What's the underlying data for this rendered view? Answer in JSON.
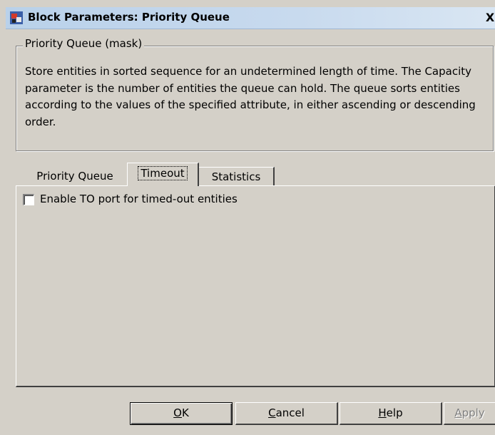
{
  "window": {
    "title": "Block Parameters: Priority Queue",
    "close_label": "X"
  },
  "mask": {
    "group_title": "Priority Queue (mask)",
    "description": "Store entities in sorted sequence for an undetermined length of time. The Capacity parameter is the number of entities the queue can hold. The queue sorts entities according to the values of the specified attribute, in either ascending or descending order."
  },
  "tabs": [
    {
      "label": "Priority Queue",
      "active": false
    },
    {
      "label": "Timeout",
      "active": true
    },
    {
      "label": "Statistics",
      "active": false
    }
  ],
  "timeout_panel": {
    "enable_to_port_label": "Enable TO port for timed-out entities",
    "enable_to_port_checked": false
  },
  "buttons": {
    "ok_mnemonic": "O",
    "ok_rest": "K",
    "cancel_mnemonic": "C",
    "cancel_rest": "ancel",
    "help_mnemonic": "H",
    "help_rest": "elp",
    "apply_mnemonic": "A",
    "apply_rest": "pply"
  },
  "icons": {
    "app": "simulink-block-icon",
    "close": "close-icon"
  }
}
